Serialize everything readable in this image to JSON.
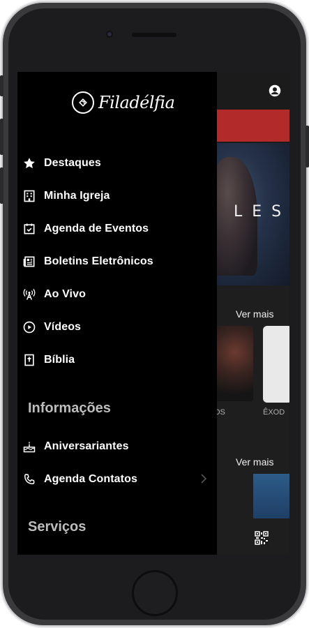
{
  "app": {
    "brand_name": "Filadélfia"
  },
  "background": {
    "banner_text": "LES",
    "ver_mais_1": "Ver mais",
    "ver_mais_2": "Ver mais",
    "thumb1_label": "OS",
    "thumb2_label": "ÊXOD",
    "thumb1_overlay": "ÊXODOS"
  },
  "drawer": {
    "items": [
      {
        "label": "Destaques",
        "icon": "star-icon"
      },
      {
        "label": "Minha Igreja",
        "icon": "building-icon"
      },
      {
        "label": "Agenda de Eventos",
        "icon": "calendar-check-icon"
      },
      {
        "label": "Boletins Eletrônicos",
        "icon": "newspaper-icon"
      },
      {
        "label": "Ao Vivo",
        "icon": "broadcast-tower-icon"
      },
      {
        "label": "Vídeos",
        "icon": "play-circle-icon"
      },
      {
        "label": "Bíblia",
        "icon": "bible-icon"
      }
    ],
    "sections": [
      {
        "title": "Informações",
        "items": [
          {
            "label": "Aniversariantes",
            "icon": "birthday-cake-icon"
          },
          {
            "label": "Agenda Contatos",
            "icon": "phone-icon",
            "has_chevron": true
          }
        ]
      },
      {
        "title": "Serviços",
        "items": []
      }
    ]
  },
  "colors": {
    "drawer_bg": "#000000",
    "accent_red": "#b22a2a",
    "section_header": "#bdbdbd"
  }
}
